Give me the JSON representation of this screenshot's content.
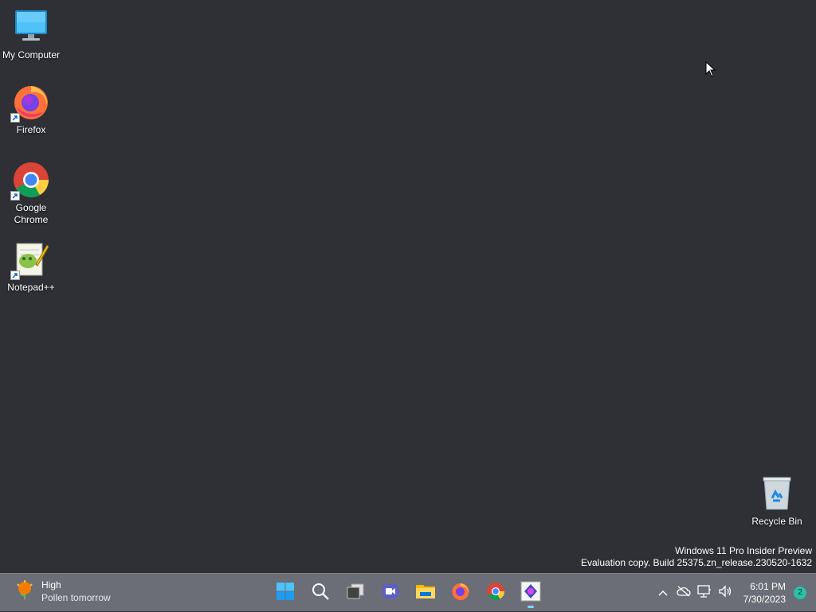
{
  "desktop": {
    "icons": [
      {
        "label": "My Computer",
        "icon": "monitor-icon"
      },
      {
        "label": "Firefox",
        "icon": "firefox-icon"
      },
      {
        "label": "Google Chrome",
        "icon": "chrome-icon"
      },
      {
        "label": "Notepad++",
        "icon": "notepadpp-icon"
      },
      {
        "label": "Recycle Bin",
        "icon": "recycle-bin-icon"
      }
    ],
    "watermark": {
      "line1": "Windows 11 Pro Insider Preview",
      "line2": "Evaluation copy. Build 25375.zn_release.230520-1632"
    }
  },
  "taskbar": {
    "weather": {
      "title": "High",
      "subtitle": "Pollen tomorrow",
      "icon": "pollen-icon"
    },
    "pinned": [
      {
        "name": "Start",
        "icon": "windows-start-icon"
      },
      {
        "name": "Search",
        "icon": "search-icon"
      },
      {
        "name": "Task View",
        "icon": "task-view-icon"
      },
      {
        "name": "Meet",
        "icon": "meet-icon"
      },
      {
        "name": "File Explorer",
        "icon": "file-explorer-icon"
      },
      {
        "name": "Firefox",
        "icon": "firefox-icon"
      },
      {
        "name": "Google Chrome",
        "icon": "chrome-icon"
      },
      {
        "name": "Active App",
        "icon": "app-icon",
        "active": true
      }
    ],
    "tray": {
      "icons": [
        "chevron-up-icon",
        "onedrive-offline-icon",
        "network-icon",
        "volume-icon"
      ],
      "time": "6:01 PM",
      "date": "7/30/2023",
      "notification_count": "2"
    }
  },
  "colors": {
    "desktop_bg": "#2e3036",
    "taskbar_bg": "#6b6e76",
    "badge": "#27c3a6",
    "active_indicator": "#7fd3ff"
  }
}
